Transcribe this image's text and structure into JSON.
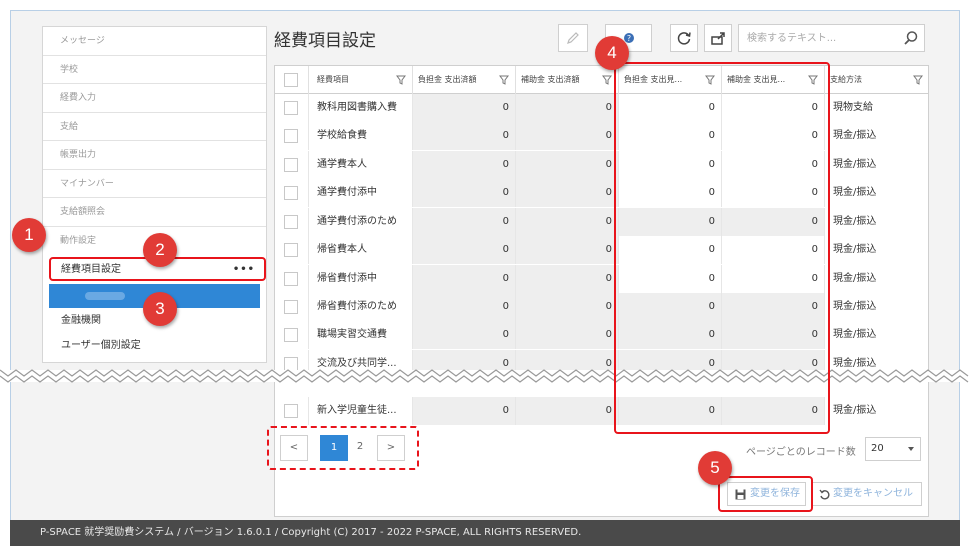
{
  "sidebar": {
    "items": [
      {
        "label": "メッセージ"
      },
      {
        "label": "学校"
      },
      {
        "label": "経費入力"
      },
      {
        "label": "支給"
      },
      {
        "label": "帳票出力"
      },
      {
        "label": "マイナンバー"
      },
      {
        "label": "支給額照会"
      },
      {
        "label": "動作設定"
      }
    ],
    "sub_items": [
      {
        "label": "経費項目設定",
        "more": "•••"
      },
      {
        "label": "金融機関"
      },
      {
        "label": "ユーザー個別設定"
      }
    ]
  },
  "header": {
    "title": "経費項目設定",
    "search_placeholder": "検索するテキスト..."
  },
  "grid": {
    "columns": [
      {
        "label": "経費項目"
      },
      {
        "label": "負担金 支出済額"
      },
      {
        "label": "補助金 支出済額"
      },
      {
        "label": "負担金 支出見..."
      },
      {
        "label": "補助金 支出見..."
      },
      {
        "label": "支給方法"
      }
    ],
    "rows": [
      {
        "item": "教科用図書購入費",
        "a": "0",
        "b": "0",
        "c": "0",
        "d": "0",
        "method": "現物支給"
      },
      {
        "item": "学校給食費",
        "a": "0",
        "b": "0",
        "c": "0",
        "d": "0",
        "method": "現金/振込"
      },
      {
        "item": "通学費本人",
        "a": "0",
        "b": "0",
        "c": "0",
        "d": "0",
        "method": "現金/振込"
      },
      {
        "item": "通学費付添中",
        "a": "0",
        "b": "0",
        "c": "0",
        "d": "0",
        "method": "現金/振込"
      },
      {
        "item": "通学費付添のため",
        "a": "0",
        "b": "0",
        "c": "0",
        "d": "0",
        "method": "現金/振込"
      },
      {
        "item": "帰省費本人",
        "a": "0",
        "b": "0",
        "c": "0",
        "d": "0",
        "method": "現金/振込"
      },
      {
        "item": "帰省費付添中",
        "a": "0",
        "b": "0",
        "c": "0",
        "d": "0",
        "method": "現金/振込"
      },
      {
        "item": "帰省費付添のため",
        "a": "0",
        "b": "0",
        "c": "0",
        "d": "0",
        "method": "現金/振込"
      },
      {
        "item": "職場実習交通費",
        "a": "0",
        "b": "0",
        "c": "0",
        "d": "0",
        "method": "現金/振込"
      },
      {
        "item": "交流及び共同学...",
        "a": "0",
        "b": "0",
        "c": "0",
        "d": "0",
        "method": "現金/振込"
      },
      {
        "item": "新入学児童生徒...",
        "a": "0",
        "b": "0",
        "c": "0",
        "d": "0",
        "method": "現金/振込"
      }
    ]
  },
  "pagination": {
    "prev": "<",
    "next": ">",
    "pages": [
      "1",
      "2"
    ],
    "per_page_label": "ページごとのレコード数",
    "per_page_value": "20"
  },
  "actions": {
    "save_label": "変更を保存",
    "cancel_label": "変更をキャンセル"
  },
  "footer": {
    "text": "P-SPACE 就学奨励費システム / バージョン 1.6.0.1 / Copyright (C) 2017 - 2022 P-SPACE, ALL RIGHTS RESERVED."
  },
  "annotations": [
    "1",
    "2",
    "3",
    "4",
    "5"
  ],
  "colors": {
    "accent": "#2f87d6",
    "highlight": "#e8141b",
    "badge": "#e13b36",
    "footer": "#4a4a4a"
  }
}
